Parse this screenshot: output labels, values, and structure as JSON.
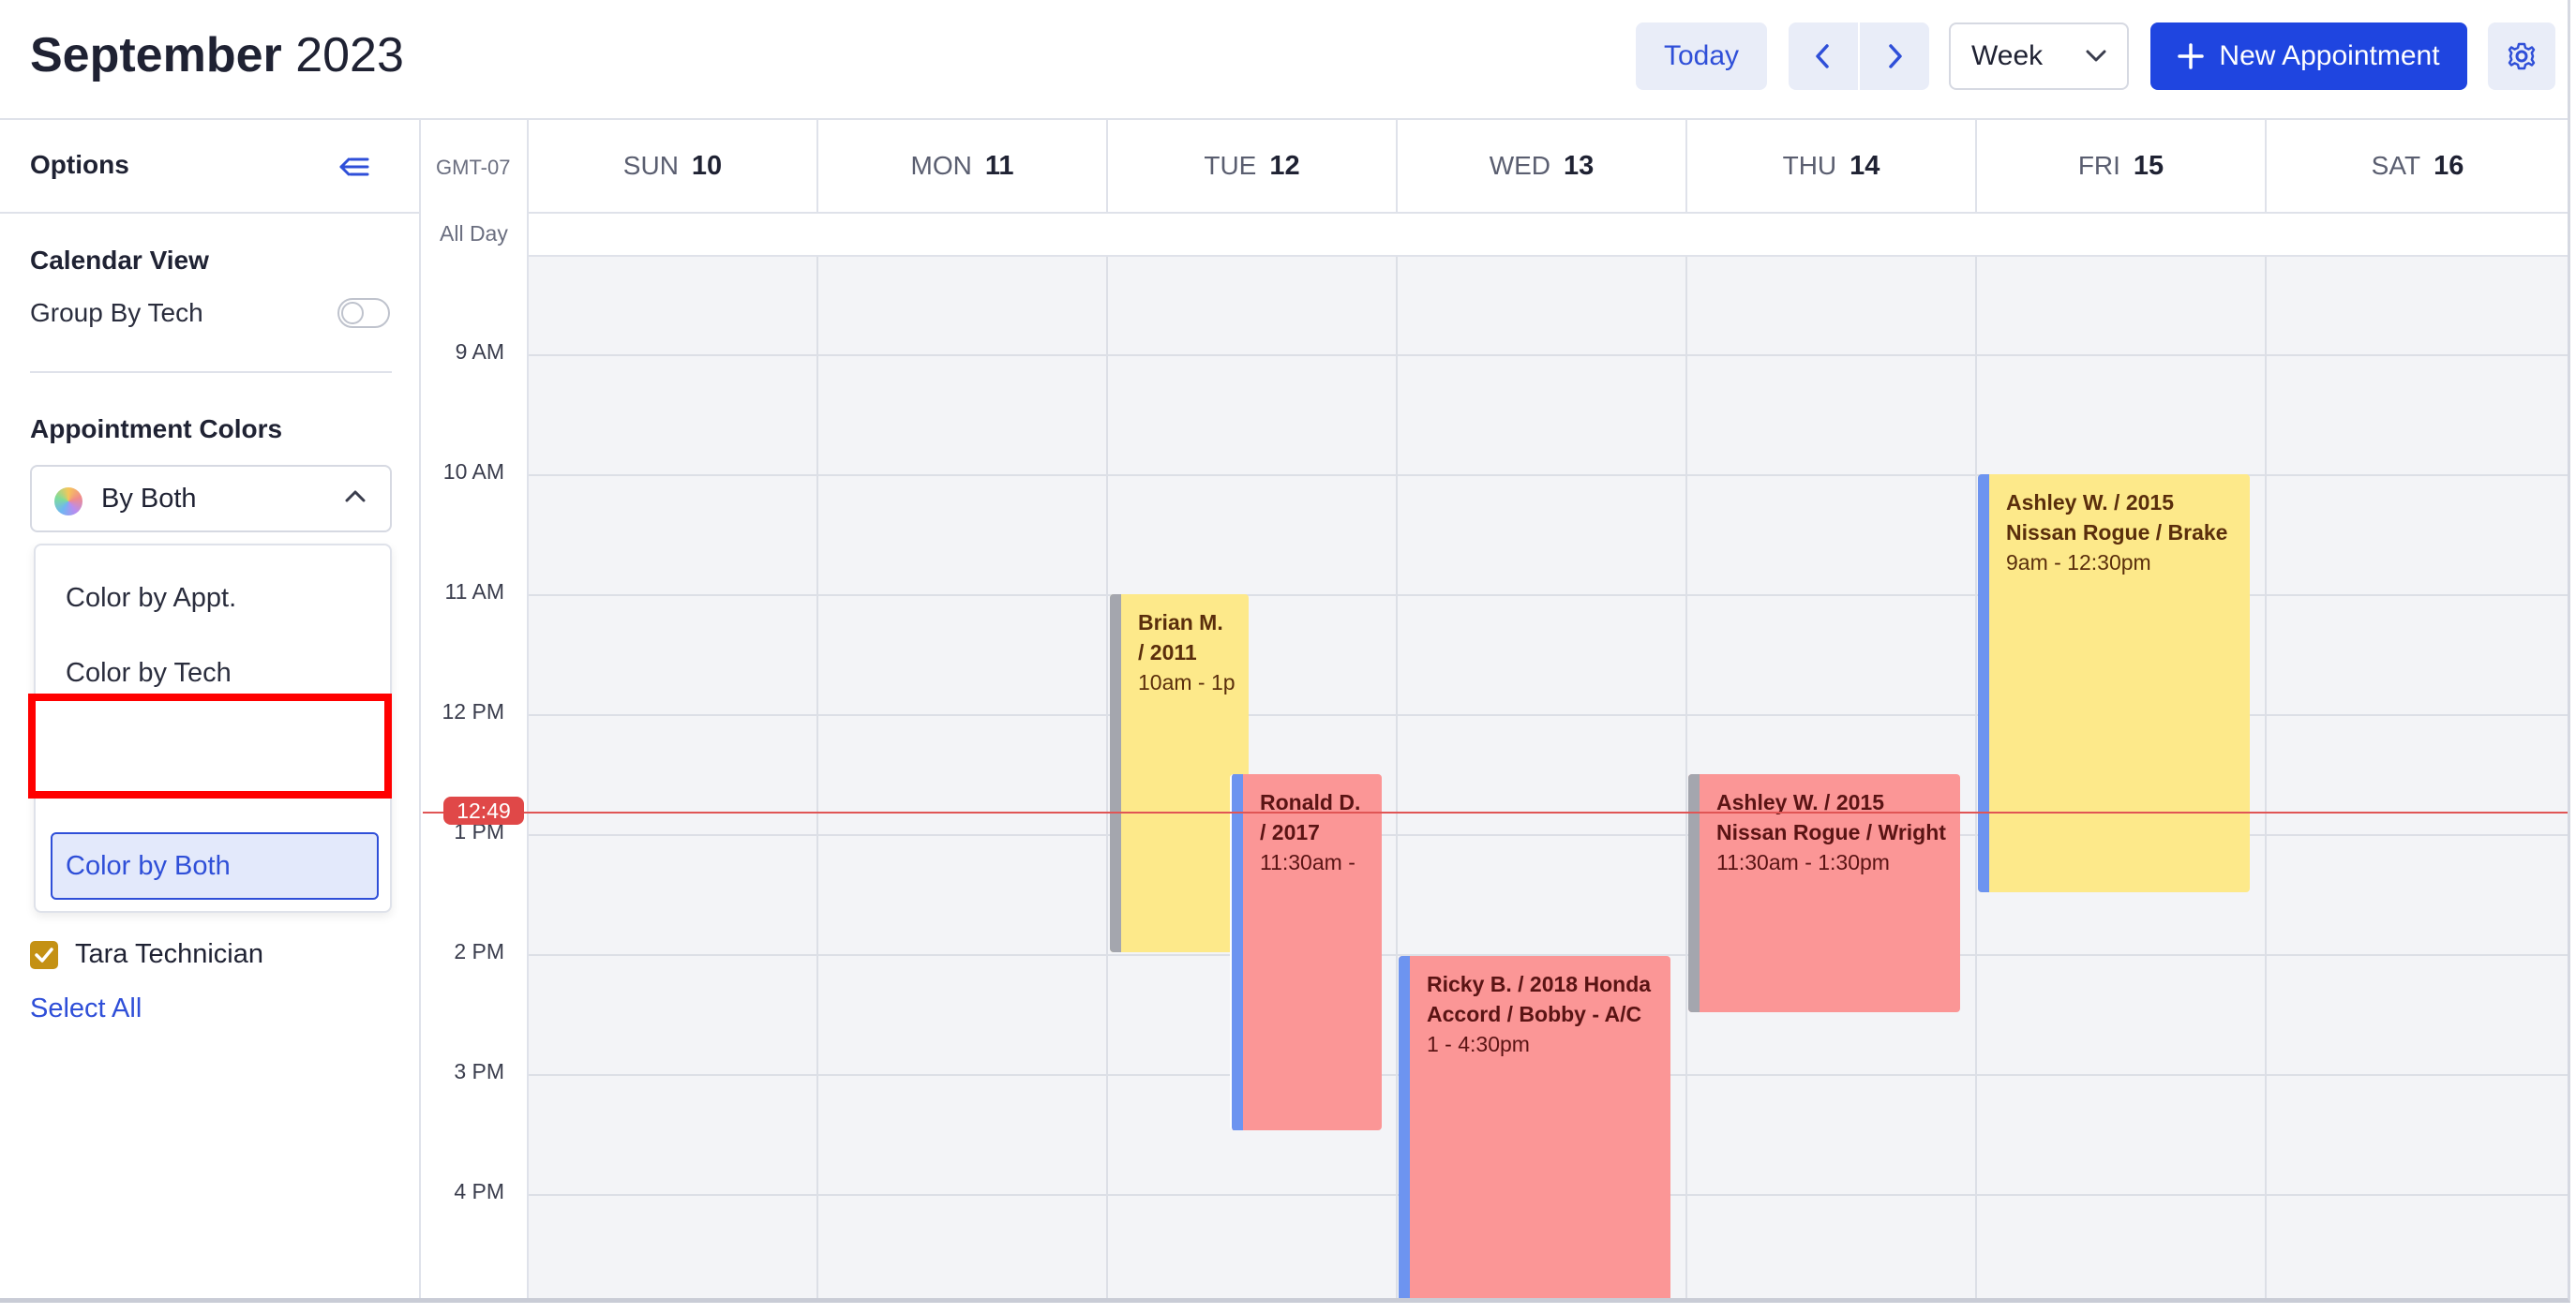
{
  "header": {
    "month": "September",
    "year": "2023",
    "today_label": "Today",
    "view_label": "Week",
    "new_appt_label": "New Appointment"
  },
  "sidebar": {
    "options_title": "Options",
    "calendar_view_title": "Calendar View",
    "group_by_tech_label": "Group By Tech",
    "group_by_tech_on": false,
    "appt_colors_title": "Appointment Colors",
    "color_select_value": "By Both",
    "dropdown_options": [
      "Color by Appt.",
      "Color by Tech",
      "Color by Both"
    ],
    "dropdown_selected": "Color by Both",
    "tech_label": "Tara Technician",
    "tech_checked": true,
    "select_all_label": "Select All"
  },
  "calendar": {
    "timezone": "GMT-07",
    "all_day_label": "All Day",
    "days": [
      {
        "dow": "SUN",
        "num": "10"
      },
      {
        "dow": "MON",
        "num": "11"
      },
      {
        "dow": "TUE",
        "num": "12"
      },
      {
        "dow": "WED",
        "num": "13"
      },
      {
        "dow": "THU",
        "num": "14"
      },
      {
        "dow": "FRI",
        "num": "15"
      },
      {
        "dow": "SAT",
        "num": "16"
      }
    ],
    "hours": [
      "9 AM",
      "10 AM",
      "11 AM",
      "12 PM",
      "1 PM",
      "2 PM",
      "3 PM",
      "4 PM"
    ],
    "now_label": "12:49",
    "appointments": [
      {
        "day": "TUE",
        "title": "Brian M. / 2011",
        "time": "10am - 1p",
        "color": "yellow"
      },
      {
        "day": "TUE",
        "title": "Ronald D. / 2017",
        "time": "11:30am -",
        "color": "red"
      },
      {
        "day": "WED",
        "title": "Ricky B. / 2018 Honda Accord / Bobby - A/C",
        "time": "1 - 4:30pm",
        "color": "red"
      },
      {
        "day": "THU",
        "title": "Ashley W. / 2015 Nissan Rogue / Wright",
        "time": "11:30am - 1:30pm",
        "color": "red"
      },
      {
        "day": "FRI",
        "title": "Ashley W. / 2015 Nissan Rogue / Brake",
        "time": "9am - 12:30pm",
        "color": "yellow"
      }
    ]
  },
  "colors": {
    "accent": "#1f45e0",
    "now_line": "#e04848",
    "appt_yellow": "#fde98a",
    "appt_red": "#fb9696",
    "tech_bar_blue": "#6d94f0",
    "tech_bar_gray": "#a4a6ae"
  }
}
